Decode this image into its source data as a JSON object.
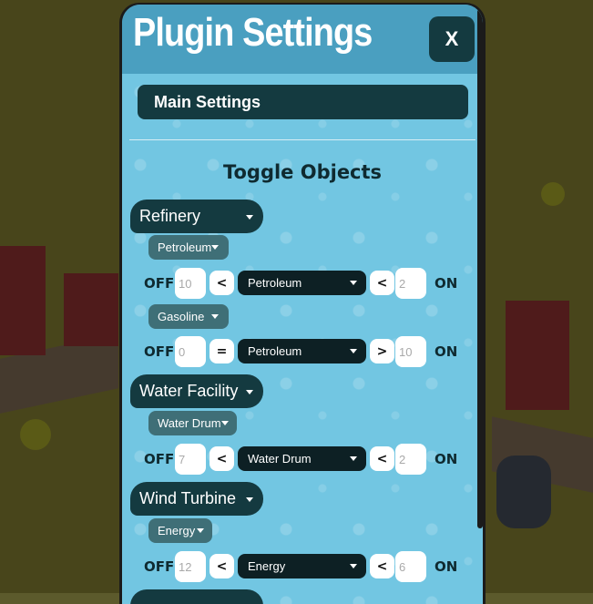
{
  "window": {
    "title": "Plugin Settings",
    "close_label": "X"
  },
  "tabs": {
    "main": "Main Settings"
  },
  "section": {
    "title": "Toggle Objects"
  },
  "labels": {
    "off": "OFF",
    "on": "ON"
  },
  "objects": [
    {
      "name": "Refinery",
      "rules": [
        {
          "resource": "Petroleum",
          "off_value": "10",
          "op1": "<",
          "selected": "Petroleum",
          "op2": "<",
          "on_value": "2"
        },
        {
          "resource": "Gasoline",
          "off_value": "0",
          "op1": "=",
          "selected": "Petroleum",
          "op2": ">",
          "on_value": "10"
        }
      ]
    },
    {
      "name": "Water Facility",
      "rules": [
        {
          "resource": "Water Drum",
          "off_value": "7",
          "op1": "<",
          "selected": "Water Drum",
          "op2": "<",
          "on_value": "2"
        }
      ]
    },
    {
      "name": "Wind Turbine",
      "rules": [
        {
          "resource": "Energy",
          "off_value": "12",
          "op1": "<",
          "selected": "Energy",
          "op2": "<",
          "on_value": "6"
        }
      ]
    }
  ],
  "colors": {
    "header": "#4a9fc0",
    "panel_bg": "#72c6e2",
    "dark_button": "#143a40",
    "resource_button": "#3f6f77",
    "select_bg": "#0d2024"
  }
}
